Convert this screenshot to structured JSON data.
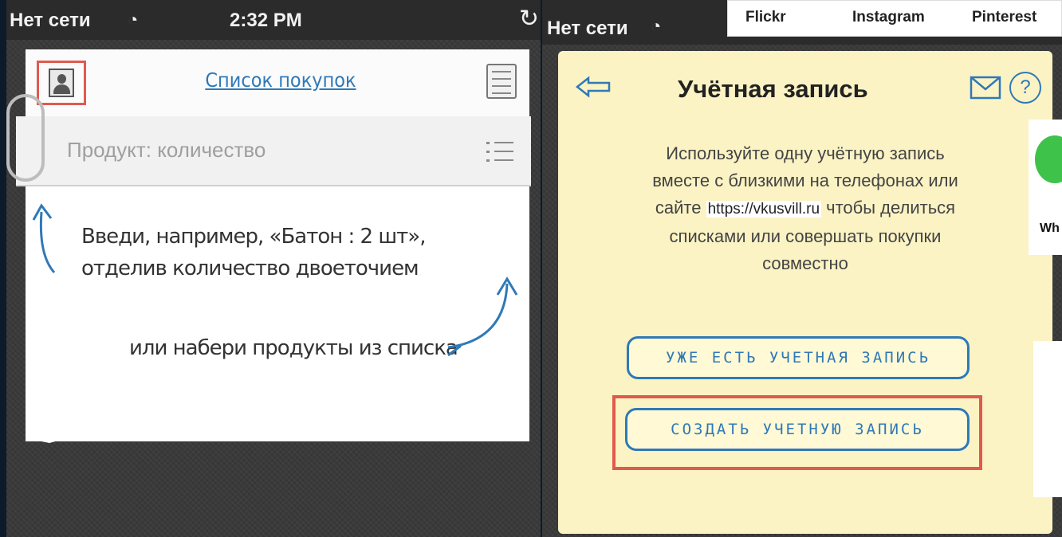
{
  "left_screen": {
    "status": {
      "carrier": "Нет сети",
      "time": "2:32 PM"
    },
    "header": {
      "title": "Список покупок"
    },
    "input": {
      "placeholder": "Продукт: количество"
    },
    "hint_1": {
      "line1": "Введи, например,  «Батон : 2 шт»,",
      "line2": "отделив количество двоеточием"
    },
    "hint_2": "или набери продукты из списка"
  },
  "right_screen": {
    "status": {
      "carrier": "Нет сети"
    },
    "title": "Учётная запись",
    "description": {
      "line1": "Используйте одну учётную запись",
      "line2": "вместе с близкими на телефонах или",
      "line3_before": "сайте ",
      "url": "https://vkusvill.ru",
      "line3_after": " чтобы делиться",
      "line4": "списками или совершать покупки",
      "line5": "совместно"
    },
    "buttons": {
      "login": "УЖЕ ЕСТЬ УЧЕТНАЯ ЗАПИСЬ",
      "create": "СОЗДАТЬ УЧЕТНУЮ ЗАПИСЬ"
    }
  },
  "overlay": {
    "social": [
      "Flickr",
      "Instagram",
      "Pinterest"
    ],
    "side_label": "Wh"
  },
  "colors": {
    "accent_blue": "#2f79b8",
    "highlight_red": "#e05a4e",
    "card_yellow": "#fbf3c4"
  }
}
